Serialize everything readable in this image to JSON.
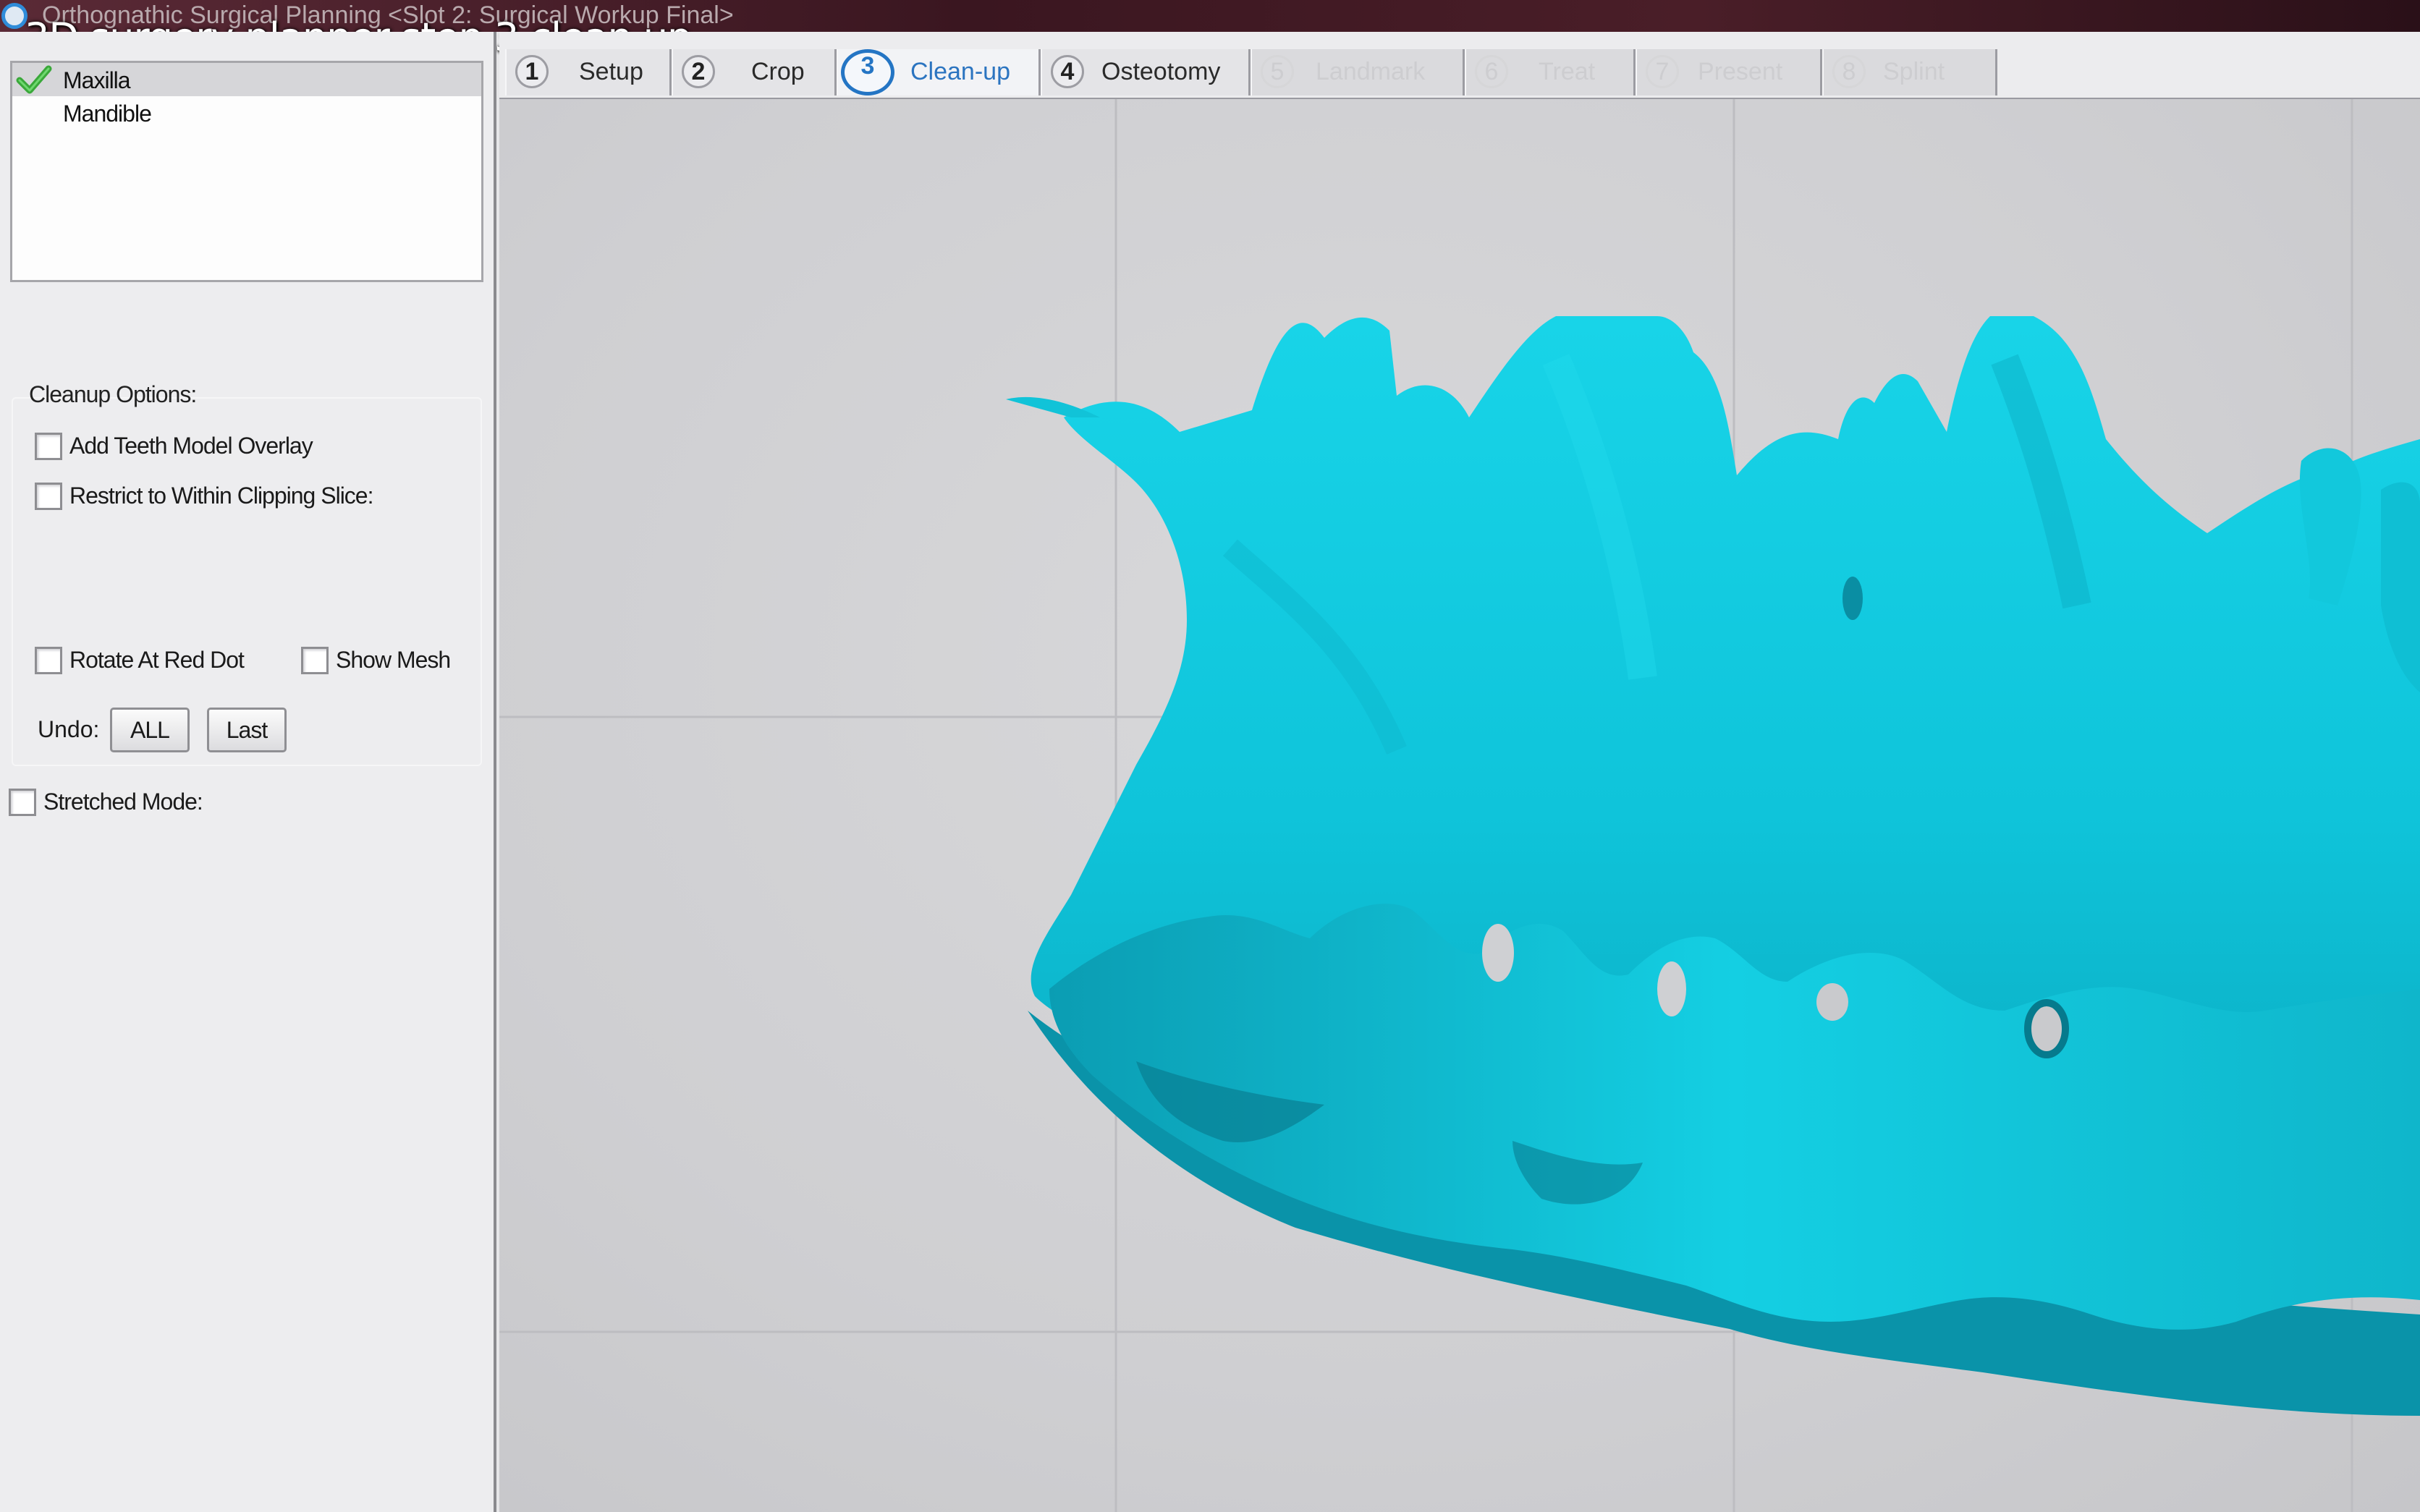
{
  "window": {
    "title": "Orthognathic Surgical Planning <Slot 2: Surgical Workup Final>",
    "caption": "3D surgery planner step 3 clean up"
  },
  "structures": [
    {
      "label": "Maxilla",
      "checked": true,
      "selected": true
    },
    {
      "label": "Mandible",
      "checked": false,
      "selected": false
    }
  ],
  "cleanup": {
    "title": "Cleanup Options:",
    "add_teeth_overlay": {
      "label": "Add Teeth Model Overlay",
      "checked": false
    },
    "restrict_clipping": {
      "label": "Restrict to Within Clipping Slice:",
      "checked": false
    },
    "rotate_red_dot": {
      "label": "Rotate At Red Dot",
      "checked": false
    },
    "show_mesh": {
      "label": "Show Mesh",
      "checked": false
    },
    "undo_label": "Undo:",
    "undo_all": "ALL",
    "undo_last": "Last"
  },
  "stretched_mode": {
    "label": "Stretched Mode:",
    "checked": false
  },
  "tabs": [
    {
      "num": "1",
      "label": "Setup",
      "state": "normal"
    },
    {
      "num": "2",
      "label": "Crop",
      "state": "normal"
    },
    {
      "num": "3",
      "label": "Clean-up",
      "state": "active"
    },
    {
      "num": "4",
      "label": "Osteotomy",
      "state": "normal"
    },
    {
      "num": "5",
      "label": "Landmark",
      "state": "disabled"
    },
    {
      "num": "6",
      "label": "Treat",
      "state": "disabled"
    },
    {
      "num": "7",
      "label": "Present",
      "state": "disabled"
    },
    {
      "num": "8",
      "label": "Splint",
      "state": "disabled"
    }
  ],
  "colors": {
    "model": "#10c8dc",
    "model_shadow": "#0a8fa6",
    "active_tab": "#2b74c0"
  },
  "viewport": {
    "model": "Maxilla 3D bone model"
  }
}
